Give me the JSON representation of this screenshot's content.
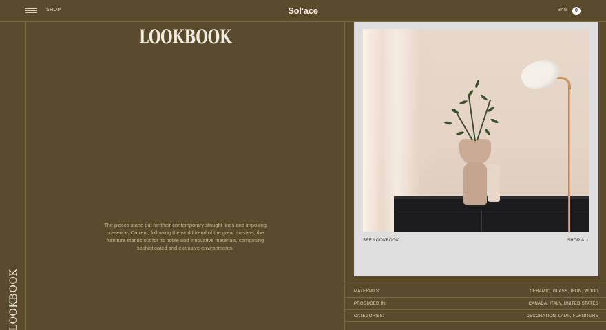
{
  "header": {
    "shop_label": "SHOP",
    "logo": "Sol'ace",
    "bag_label": "BAG",
    "bag_count": "0"
  },
  "sidebar": {
    "vertical_title": "LOOKBOOK"
  },
  "main": {
    "title": "LOOKBOOK",
    "description": "The pieces stand out for their contemporary straight lines and imposing presence. Current, following the world trend of the great masters, the furniture stands out for its noble and innovative materials, composing sophisticated and exclusive environments."
  },
  "card": {
    "see_lookbook_label": "SEE LOOKBOOK",
    "shop_all_label": "SHOP ALL"
  },
  "specs": [
    {
      "label": "MATERIALS:",
      "value": "CERAMIC, GLASS, IRON, WOOD"
    },
    {
      "label": "PRODUCED IN:",
      "value": "CANADA, ITALY, UNITED STATES"
    },
    {
      "label": "CATEGORIES:",
      "value": "DECORATION, LAMP, FURNITURE"
    }
  ],
  "colors": {
    "background": "#5a4b2d",
    "divider": "#786948",
    "text": "#e9e1cf",
    "card": "#dedede"
  },
  "icons": {
    "menu": "hamburger-icon"
  }
}
